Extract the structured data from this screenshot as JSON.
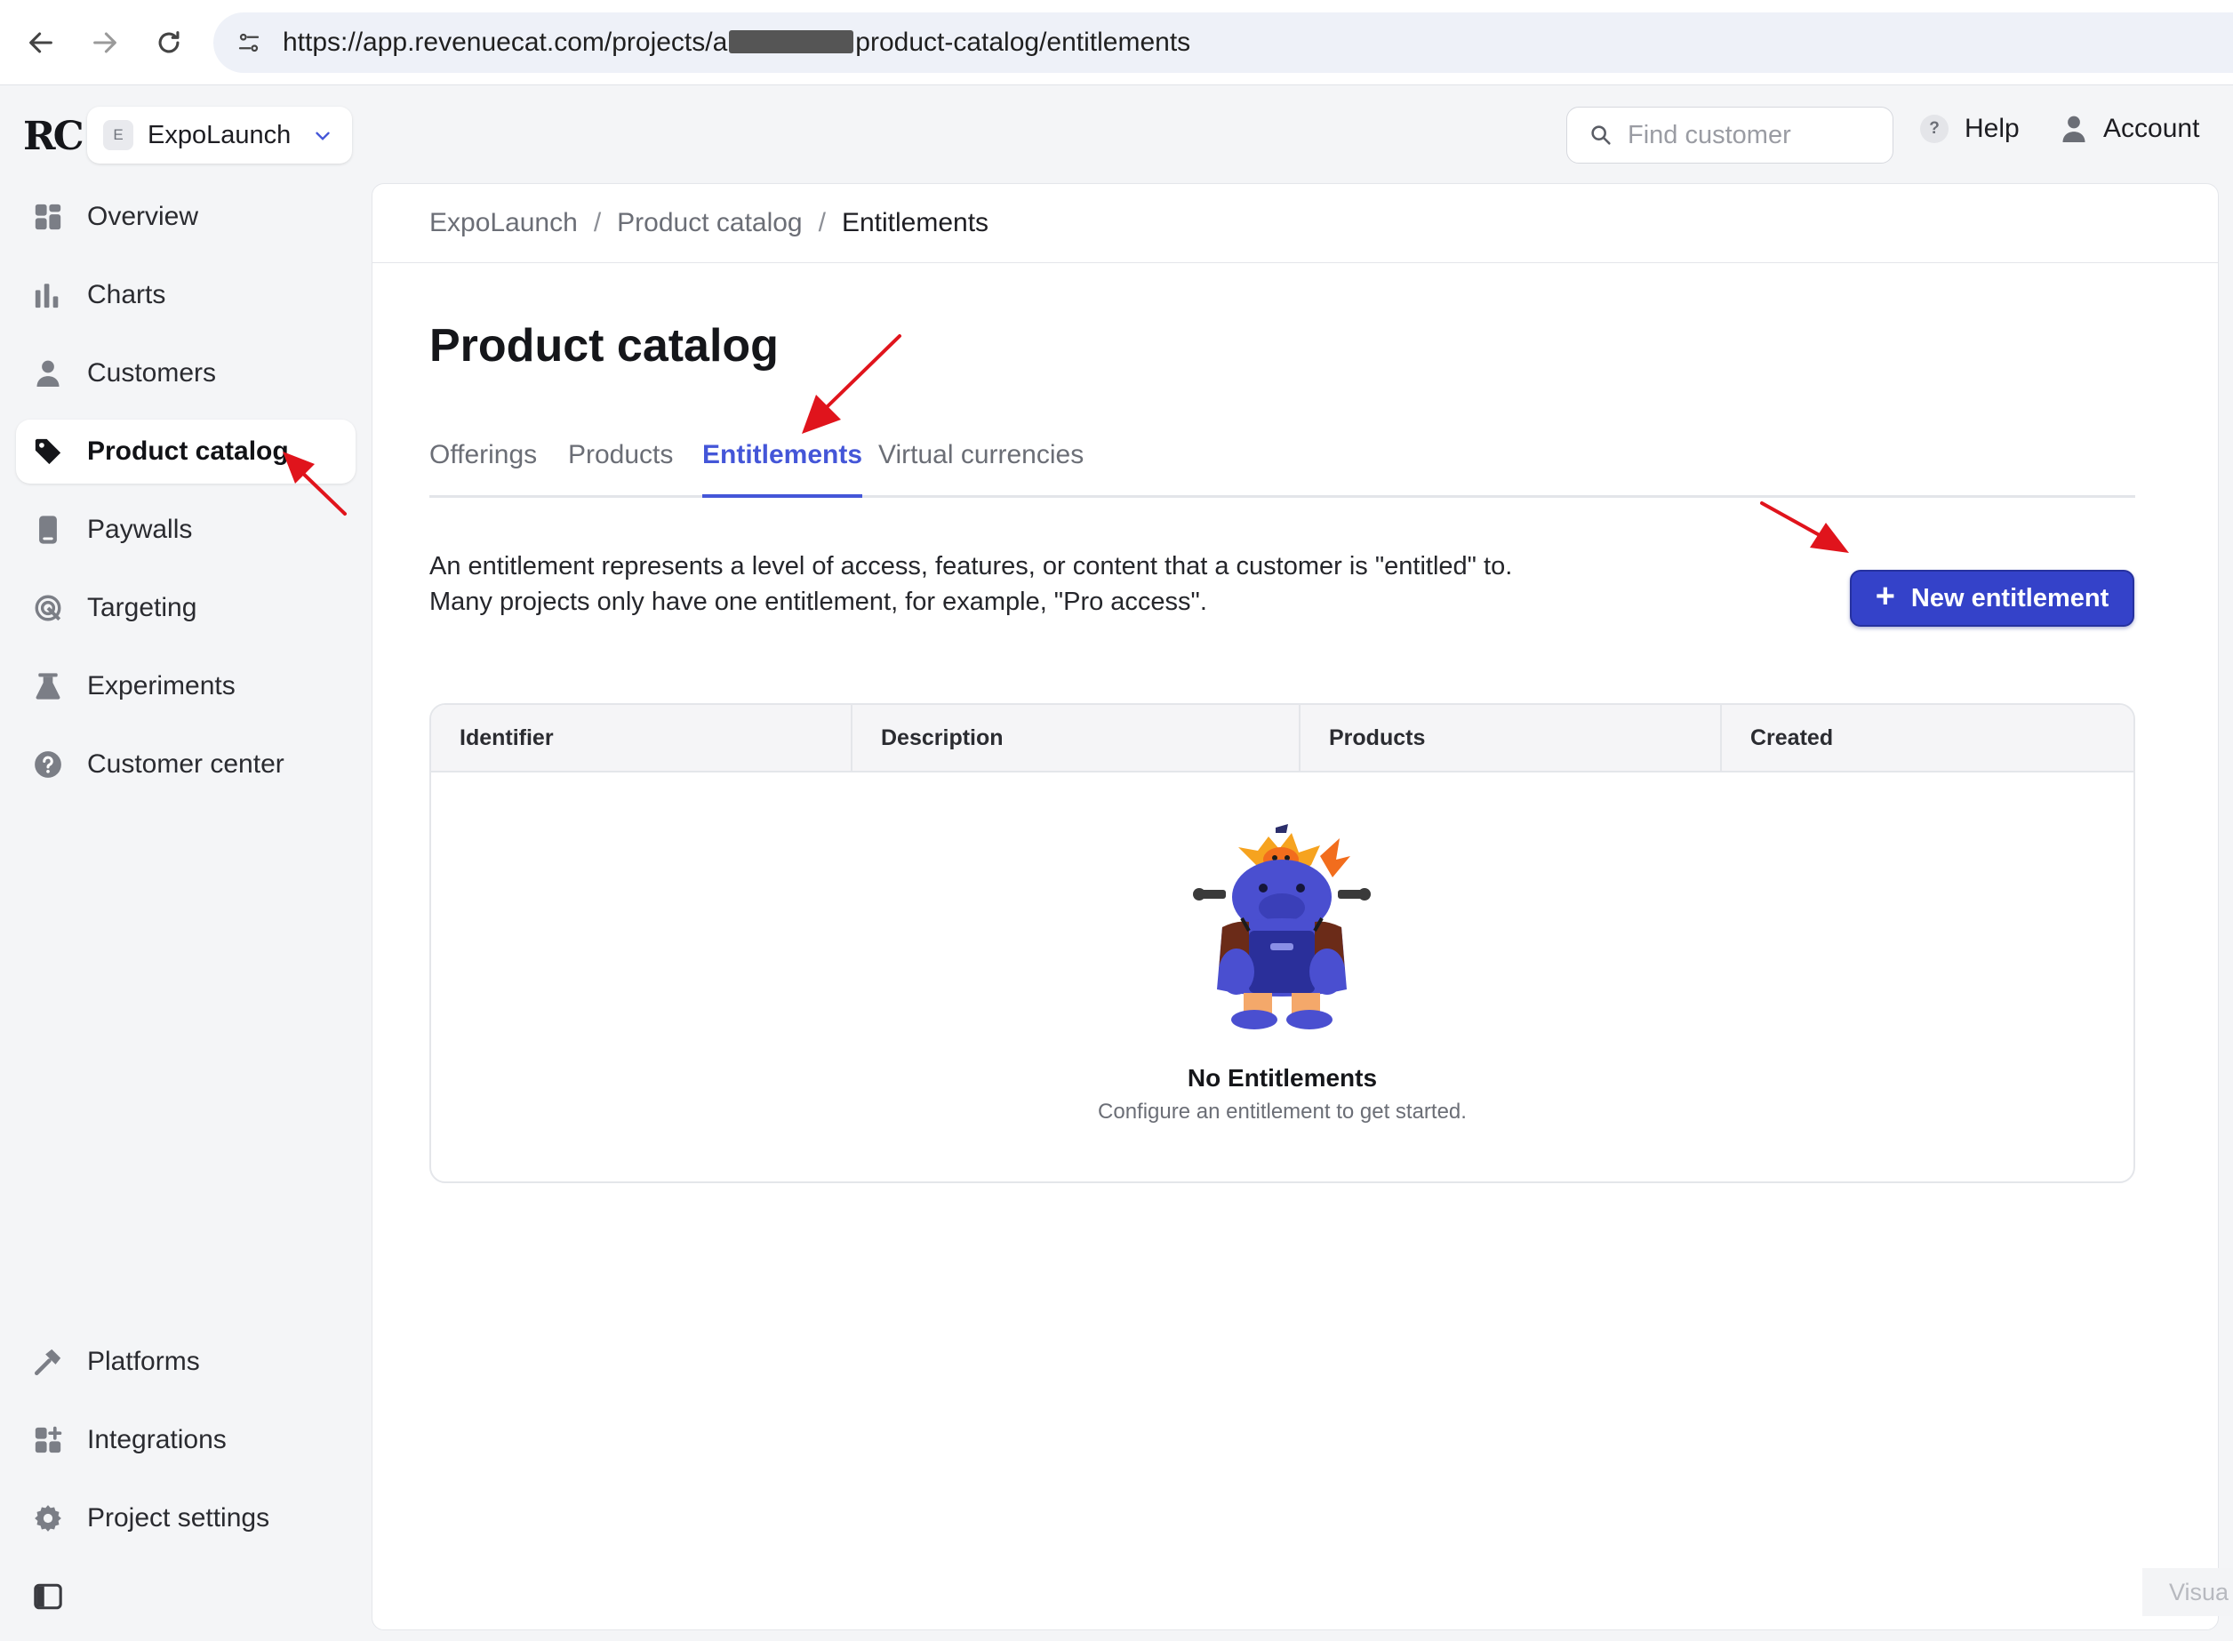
{
  "browser": {
    "url_prefix": "https://app.revenuecat.com/projects/a",
    "url_suffix": "product-catalog/entitlements"
  },
  "app": {
    "logo": "RC",
    "project_badge": "E",
    "project_name": "ExpoLaunch",
    "search_placeholder": "Find customer",
    "help_label": "Help",
    "help_glyph": "?",
    "account_label": "Account"
  },
  "sidebar": {
    "items": [
      {
        "label": "Overview",
        "icon": "grid-icon"
      },
      {
        "label": "Charts",
        "icon": "bar-chart-icon"
      },
      {
        "label": "Customers",
        "icon": "person-icon"
      },
      {
        "label": "Product catalog",
        "icon": "tag-icon",
        "active": true
      },
      {
        "label": "Paywalls",
        "icon": "phone-icon"
      },
      {
        "label": "Targeting",
        "icon": "target-icon"
      },
      {
        "label": "Experiments",
        "icon": "flask-icon"
      },
      {
        "label": "Customer center",
        "icon": "help-circle-icon"
      }
    ],
    "bottom_items": [
      {
        "label": "Platforms",
        "icon": "hammer-icon"
      },
      {
        "label": "Integrations",
        "icon": "grid-plus-icon"
      },
      {
        "label": "Project settings",
        "icon": "gear-icon"
      }
    ]
  },
  "breadcrumb": [
    "ExpoLaunch",
    "Product catalog",
    "Entitlements"
  ],
  "breadcrumb_separator": "/",
  "page": {
    "title": "Product catalog",
    "tabs": [
      "Offerings",
      "Products",
      "Entitlements",
      "Virtual currencies"
    ],
    "active_tab": "Entitlements",
    "description_line1": "An entitlement represents a level of access, features, or content that a customer is \"entitled\" to.",
    "description_line2": "Many projects only have one entitlement, for example, \"Pro access\".",
    "new_button_plus": "+",
    "new_button": "New entitlement"
  },
  "table": {
    "headers": [
      "Identifier",
      "Description",
      "Products",
      "Created"
    ],
    "empty_title": "No Entitlements",
    "empty_subtitle": "Configure an entitlement to get started."
  },
  "corner_label": "Visua",
  "colors": {
    "accent": "#4456d8",
    "button": "#3442c9",
    "annotation_arrow": "#e0141c"
  }
}
